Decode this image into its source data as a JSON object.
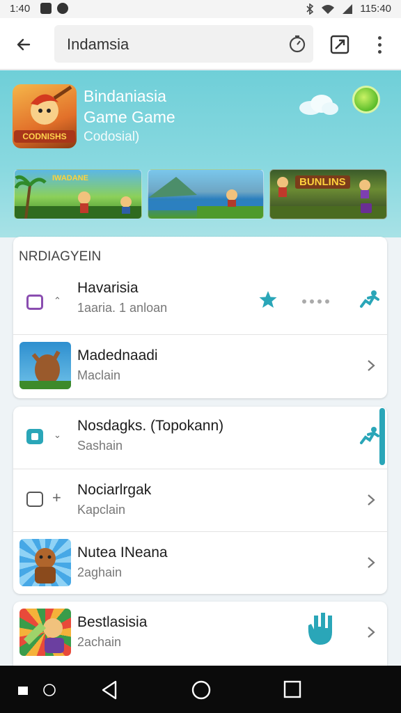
{
  "status_bar": {
    "time": "1:40",
    "right_text": "115:40"
  },
  "search": {
    "query": "Indamsia"
  },
  "hero": {
    "title_line1": "Bindaniasia",
    "title_line2": "Game Game",
    "subtitle": "Codosial)",
    "icon_badge": "CODNISHS",
    "screenshot1_banner": "IWADANE",
    "screenshot3_banner": "BUNLINS"
  },
  "section1": {
    "heading": "NRDIAGYEIN",
    "rows": [
      {
        "name": "Havarisia",
        "meta": "1aaria. 1 anloan"
      },
      {
        "name": "Madednaadi",
        "meta": "Maclain"
      }
    ]
  },
  "section2": {
    "rows": [
      {
        "name": "Nosdagks. (Topokann)",
        "meta": "Sashain"
      },
      {
        "name": "Nociarlrgak",
        "meta": "Kapclain"
      },
      {
        "name": "Nutea INeana",
        "meta": "2aghain"
      }
    ]
  },
  "section3": {
    "rows": [
      {
        "name": "Bestlasisia",
        "meta": "2achain"
      }
    ]
  },
  "colors": {
    "accent_teal": "#2aa6b8",
    "hero_bg": "#7fd4dc",
    "icon_purple": "#8a4db0"
  }
}
